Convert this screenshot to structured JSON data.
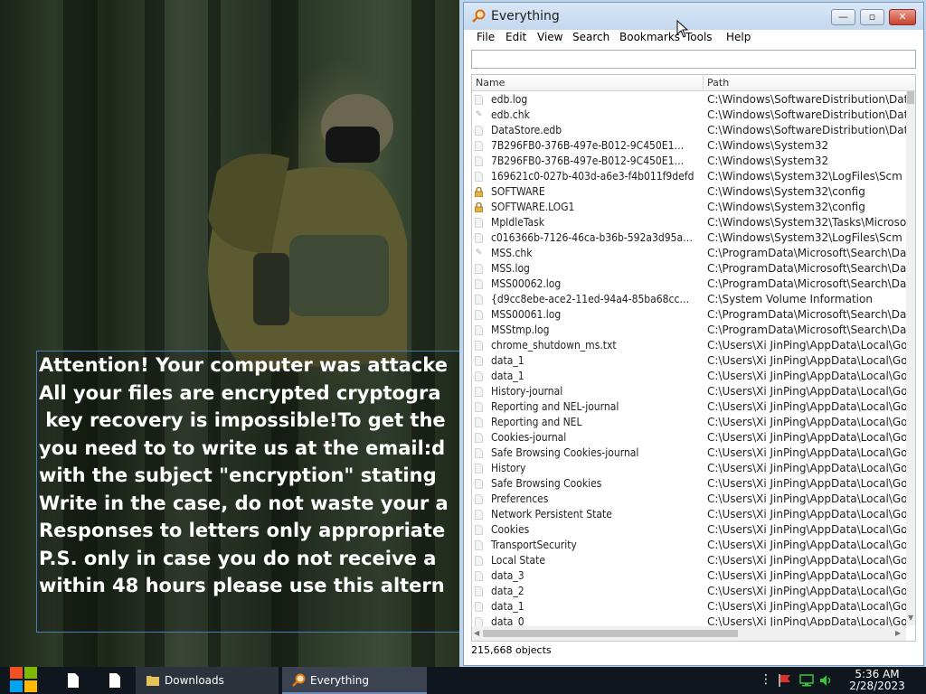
{
  "desktop": {
    "ransom_note_lines": [
      "Attention! Your computer was attacke",
      "All your files are encrypted cryptogra",
      " key recovery is impossible!To get the",
      "you need to to write us at the email:d",
      "with the subject \"encryption\" stating",
      "Write in the case, do not waste your a",
      "Responses to letters only appropriate",
      "",
      "P.S. only in case you do not receive a",
      "within 48 hours please use this altern"
    ]
  },
  "window": {
    "title": "Everything",
    "caption_buttons": {
      "minimize": "—",
      "maximize": "▫",
      "close": "✕"
    },
    "menu": [
      "File",
      "Edit",
      "View",
      "Search",
      "Bookmarks",
      "Tools",
      "Help"
    ],
    "search": {
      "value": "",
      "placeholder": ""
    },
    "columns": [
      "Name",
      "Path"
    ],
    "rows": [
      {
        "name": "edb.log",
        "path": "C:\\Windows\\SoftwareDistribution\\DataS",
        "icon": "file-icon"
      },
      {
        "name": "edb.chk",
        "path": "C:\\Windows\\SoftwareDistribution\\DataS",
        "icon": "check-file-icon"
      },
      {
        "name": "DataStore.edb",
        "path": "C:\\Windows\\SoftwareDistribution\\DataS",
        "icon": "file-icon"
      },
      {
        "name": "7B296FB0-376B-497e-B012-9C450E1…",
        "path": "C:\\Windows\\System32",
        "icon": "file-icon"
      },
      {
        "name": "7B296FB0-376B-497e-B012-9C450E1…",
        "path": "C:\\Windows\\System32",
        "icon": "file-icon"
      },
      {
        "name": "169621c0-027b-403d-a6e3-f4b011f9defd",
        "path": "C:\\Windows\\System32\\LogFiles\\Scm",
        "icon": "file-icon"
      },
      {
        "name": "SOFTWARE",
        "path": "C:\\Windows\\System32\\config",
        "icon": "lock-icon"
      },
      {
        "name": "SOFTWARE.LOG1",
        "path": "C:\\Windows\\System32\\config",
        "icon": "lock-icon"
      },
      {
        "name": "MpIdleTask",
        "path": "C:\\Windows\\System32\\Tasks\\Microsof",
        "icon": "file-icon"
      },
      {
        "name": "c016366b-7126-46ca-b36b-592a3d95a…",
        "path": "C:\\Windows\\System32\\LogFiles\\Scm",
        "icon": "file-icon"
      },
      {
        "name": "MSS.chk",
        "path": "C:\\ProgramData\\Microsoft\\Search\\Dat",
        "icon": "check-file-icon"
      },
      {
        "name": "MSS.log",
        "path": "C:\\ProgramData\\Microsoft\\Search\\Dat",
        "icon": "file-icon"
      },
      {
        "name": "MSS00062.log",
        "path": "C:\\ProgramData\\Microsoft\\Search\\Dat",
        "icon": "file-icon"
      },
      {
        "name": "{d9cc8ebe-ace2-11ed-94a4-85ba68cc…",
        "path": "C:\\System Volume Information",
        "icon": "file-icon"
      },
      {
        "name": "MSS00061.log",
        "path": "C:\\ProgramData\\Microsoft\\Search\\Dat",
        "icon": "file-icon"
      },
      {
        "name": "MSStmp.log",
        "path": "C:\\ProgramData\\Microsoft\\Search\\Dat",
        "icon": "file-icon"
      },
      {
        "name": "chrome_shutdown_ms.txt",
        "path": "C:\\Users\\Xi JinPing\\AppData\\Local\\Go",
        "icon": "file-icon"
      },
      {
        "name": "data_1",
        "path": "C:\\Users\\Xi JinPing\\AppData\\Local\\Go",
        "icon": "file-icon"
      },
      {
        "name": "data_1",
        "path": "C:\\Users\\Xi JinPing\\AppData\\Local\\Go",
        "icon": "file-icon"
      },
      {
        "name": "History-journal",
        "path": "C:\\Users\\Xi JinPing\\AppData\\Local\\Go",
        "icon": "file-icon"
      },
      {
        "name": "Reporting and NEL-journal",
        "path": "C:\\Users\\Xi JinPing\\AppData\\Local\\Go",
        "icon": "file-icon"
      },
      {
        "name": "Reporting and NEL",
        "path": "C:\\Users\\Xi JinPing\\AppData\\Local\\Go",
        "icon": "file-icon"
      },
      {
        "name": "Cookies-journal",
        "path": "C:\\Users\\Xi JinPing\\AppData\\Local\\Go",
        "icon": "file-icon"
      },
      {
        "name": "Safe Browsing Cookies-journal",
        "path": "C:\\Users\\Xi JinPing\\AppData\\Local\\Go",
        "icon": "file-icon"
      },
      {
        "name": "History",
        "path": "C:\\Users\\Xi JinPing\\AppData\\Local\\Go",
        "icon": "file-icon"
      },
      {
        "name": "Safe Browsing Cookies",
        "path": "C:\\Users\\Xi JinPing\\AppData\\Local\\Go",
        "icon": "file-icon"
      },
      {
        "name": "Preferences",
        "path": "C:\\Users\\Xi JinPing\\AppData\\Local\\Go",
        "icon": "file-icon"
      },
      {
        "name": "Network Persistent State",
        "path": "C:\\Users\\Xi JinPing\\AppData\\Local\\Go",
        "icon": "file-icon"
      },
      {
        "name": "Cookies",
        "path": "C:\\Users\\Xi JinPing\\AppData\\Local\\Go",
        "icon": "file-icon"
      },
      {
        "name": "TransportSecurity",
        "path": "C:\\Users\\Xi JinPing\\AppData\\Local\\Go",
        "icon": "file-icon"
      },
      {
        "name": "Local State",
        "path": "C:\\Users\\Xi JinPing\\AppData\\Local\\Go",
        "icon": "file-icon"
      },
      {
        "name": "data_3",
        "path": "C:\\Users\\Xi JinPing\\AppData\\Local\\Go",
        "icon": "file-icon"
      },
      {
        "name": "data_2",
        "path": "C:\\Users\\Xi JinPing\\AppData\\Local\\Go",
        "icon": "file-icon"
      },
      {
        "name": "data_1",
        "path": "C:\\Users\\Xi JinPing\\AppData\\Local\\Go",
        "icon": "file-icon"
      },
      {
        "name": "data_0",
        "path": "C:\\Users\\Xi JinPing\\AppData\\Local\\Go",
        "icon": "file-icon"
      }
    ],
    "status": "215,668 objects"
  },
  "taskbar": {
    "downloads_label": "Downloads",
    "everything_label": "Everything",
    "clock_time": "5:36 AM",
    "clock_date": "2/28/2023"
  },
  "colors": {
    "ransom_text": "#ffffff",
    "window_frame": "#bcd3ec",
    "taskbar": "#10161e",
    "lock_icon": "#b8860b"
  }
}
